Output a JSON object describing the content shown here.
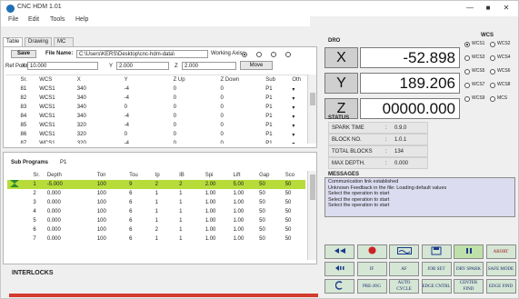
{
  "window": {
    "title": "CNC HDM 1.01",
    "min": "—",
    "max": "■",
    "close": "✕"
  },
  "menu": [
    "File",
    "Edit",
    "Tools",
    "Help"
  ],
  "tabs": [
    "Table",
    "Drawing",
    "MC Code"
  ],
  "file_bar": {
    "save_label": "Save",
    "file_name_label": "File Name:",
    "file_name_value": "C:\\Users\\KERS\\Desktop\\cnc-hdm-data\\",
    "working_axis_label": "Working Axis:"
  },
  "ref_bar": {
    "ref_point_label": "Ref Point",
    "x_label": "X",
    "x_value": "10.000",
    "y_label": "Y",
    "y_value": "2.000",
    "z_label": "Z",
    "z_value": "2.000",
    "move_label": "Move"
  },
  "main_table": {
    "headers": [
      "Sr.",
      "WCS",
      "X",
      "Y",
      "Z Up",
      "Z Down",
      "Sub",
      "Oth"
    ],
    "rows": [
      [
        "81",
        "WCS1",
        "340",
        "-4",
        "0",
        "0",
        "P1"
      ],
      [
        "82",
        "WCS1",
        "340",
        "-4",
        "0",
        "0",
        "P1"
      ],
      [
        "83",
        "WCS1",
        "340",
        "0",
        "0",
        "0",
        "P1"
      ],
      [
        "84",
        "WCS1",
        "340",
        "-4",
        "0",
        "0",
        "P1"
      ],
      [
        "85",
        "WCS1",
        "320",
        "-4",
        "0",
        "0",
        "P1"
      ],
      [
        "86",
        "WCS1",
        "320",
        "0",
        "0",
        "0",
        "P1"
      ],
      [
        "87",
        "WCS1",
        "320",
        "-4",
        "0",
        "0",
        "P1"
      ]
    ]
  },
  "sub_programs": {
    "label": "Sub Programs",
    "program": "P1",
    "headers": [
      "Sr.",
      "Depth",
      "Ton",
      "Tou",
      "Ip",
      "IB",
      "Spi",
      "Lift",
      "Gap",
      "Sco"
    ],
    "rows": [
      [
        "1",
        "-5.000",
        "100",
        "9",
        "2",
        "2",
        "2.00",
        "5.00",
        "50",
        "50"
      ],
      [
        "2",
        "0.000",
        "100",
        "6",
        "1",
        "1",
        "1.00",
        "1.00",
        "50",
        "50"
      ],
      [
        "3",
        "0.000",
        "100",
        "6",
        "1",
        "1",
        "1.00",
        "1.00",
        "50",
        "50"
      ],
      [
        "4",
        "0.000",
        "100",
        "6",
        "1",
        "1",
        "1.00",
        "1.00",
        "50",
        "50"
      ],
      [
        "5",
        "0.000",
        "100",
        "6",
        "1",
        "1",
        "1.00",
        "1.00",
        "50",
        "50"
      ],
      [
        "6",
        "0.000",
        "100",
        "6",
        "2",
        "1",
        "1.00",
        "1.00",
        "50",
        "50"
      ],
      [
        "7",
        "0.000",
        "100",
        "6",
        "1",
        "1",
        "1.00",
        "1.00",
        "50",
        "50"
      ]
    ]
  },
  "interlocks_label": "INTERLOCKS",
  "dro": {
    "title": "DRO",
    "axes": [
      {
        "axis": "X",
        "value": "-52.898"
      },
      {
        "axis": "Y",
        "value": "189.206"
      },
      {
        "axis": "Z",
        "value": "00000.000"
      }
    ]
  },
  "wcs": {
    "title": "WCS",
    "options": [
      "WCS1",
      "WCS2",
      "WCS3",
      "WCS4",
      "WCS5",
      "WCS6",
      "WCS7",
      "WCS8",
      "WCS9",
      "MCS"
    ],
    "selected": "WCS1"
  },
  "status": {
    "title": "STATUS",
    "rows": [
      {
        "label": "SPARK TIME",
        "value": "0.9.0"
      },
      {
        "label": "BLOCK NO.",
        "value": "1.0.1"
      },
      {
        "label": "TOTAL BLOCKS",
        "value": "134"
      },
      {
        "label": "MAX DEPTH.",
        "value": "0.000"
      }
    ]
  },
  "messages": {
    "title": "MESSAGES",
    "lines": [
      "Communication link established",
      "Unknown Feedback in the file: Loading default values",
      "Select the operation to start",
      "Select the operation to start",
      "Select the operation to start"
    ]
  },
  "tools_row1": [
    "jog",
    "spindle",
    "pump",
    "save",
    "pause",
    "ABORT"
  ],
  "tools_row2": [
    "jog-z",
    "IF",
    "AF",
    "JOB SET",
    "DRY SPARK",
    "SAFE MODE"
  ],
  "tools_row3": [
    "home",
    "PRE-JOG",
    "AUTO CYCLE",
    "EDGE CNTRL",
    "CENTER FIND",
    "EDGE FIND"
  ],
  "colors": {
    "selected_row": "#b7dc3a",
    "messages_bg": "#dcdcf0",
    "tool_bg": "#d5e6d5",
    "alert": "#d23b2e"
  }
}
